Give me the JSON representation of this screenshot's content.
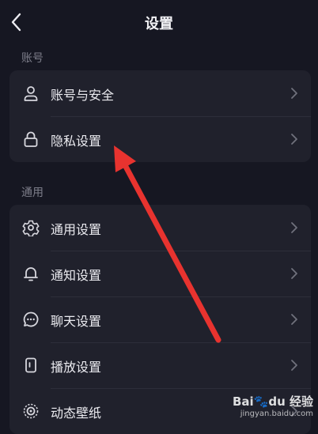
{
  "header": {
    "title": "设置",
    "back_icon": "chevron-left-icon"
  },
  "sections": [
    {
      "label": "账号",
      "items": [
        {
          "label": "账号与安全",
          "icon": "user-icon"
        },
        {
          "label": "隐私设置",
          "icon": "lock-icon"
        }
      ]
    },
    {
      "label": "通用",
      "items": [
        {
          "label": "通用设置",
          "icon": "gear-icon"
        },
        {
          "label": "通知设置",
          "icon": "bell-icon"
        },
        {
          "label": "聊天设置",
          "icon": "chat-bubble-icon"
        },
        {
          "label": "播放设置",
          "icon": "phone-play-icon"
        },
        {
          "label": "动态壁纸",
          "icon": "wallpaper-icon"
        }
      ]
    }
  ],
  "annotation": {
    "icon": "red-arrow-icon",
    "color": "#e8332f"
  },
  "watermark": {
    "brand": "Bai",
    "brand_suffix": "du",
    "product": "经验",
    "url": "jingyan.baidu.com"
  },
  "colors": {
    "background": "#161722",
    "card": "#20212c",
    "text": "#ebebf0",
    "muted": "#7d7e8a"
  }
}
